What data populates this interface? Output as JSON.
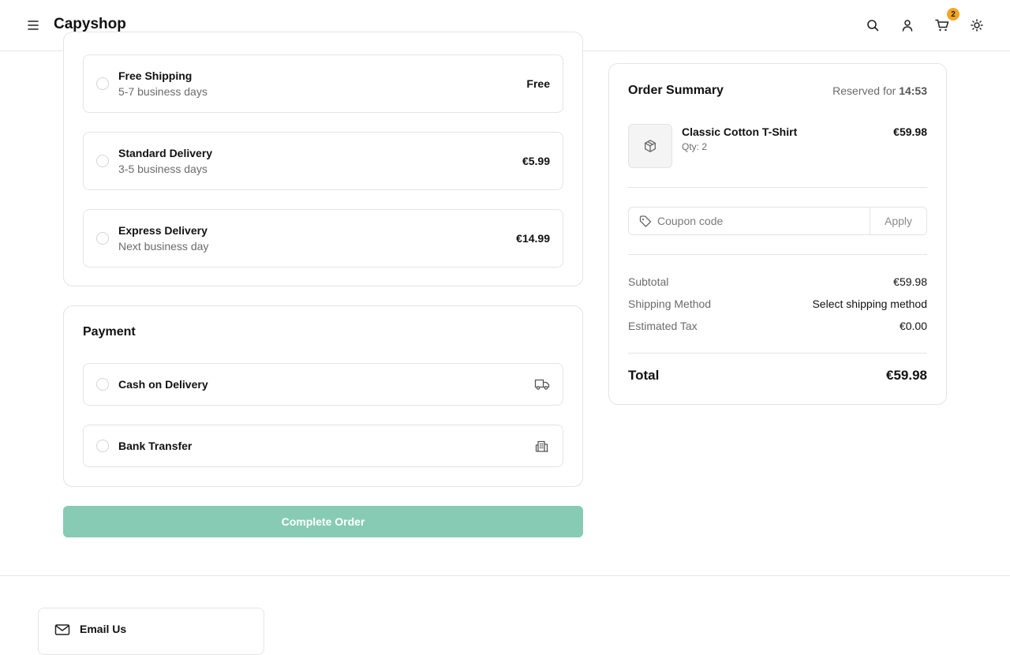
{
  "header": {
    "brand": "Capyshop",
    "cart_count": "2",
    "icons": [
      "menu-icon",
      "search-icon",
      "user-icon",
      "cart-icon",
      "sun-icon"
    ]
  },
  "shipping": {
    "options": [
      {
        "title": "Free Shipping",
        "subtitle": "5-7 business days",
        "price": "Free"
      },
      {
        "title": "Standard Delivery",
        "subtitle": "3-5 business days",
        "price": "€5.99"
      },
      {
        "title": "Express Delivery",
        "subtitle": "Next business day",
        "price": "€14.99"
      }
    ]
  },
  "payment": {
    "title": "Payment",
    "options": [
      {
        "label": "Cash on Delivery",
        "icon": "truck-icon"
      },
      {
        "label": "Bank Transfer",
        "icon": "building-icon"
      }
    ]
  },
  "complete_button": "Complete Order",
  "summary": {
    "title": "Order Summary",
    "reserved_label": "Reserved for",
    "reserved_time": "14:53",
    "item": {
      "name": "Classic Cotton T-Shirt",
      "qty": "Qty: 2",
      "price": "€59.98",
      "icon": "package-icon"
    },
    "coupon": {
      "placeholder": "Coupon code",
      "apply": "Apply",
      "icon": "tag-icon"
    },
    "rows": [
      {
        "label": "Subtotal",
        "value": "€59.98"
      },
      {
        "label": "Shipping Method",
        "value": "Select shipping method"
      },
      {
        "label": "Estimated Tax",
        "value": "€0.00"
      }
    ],
    "total_label": "Total",
    "total_value": "€59.98"
  },
  "footer": {
    "contact_title": "Email Us",
    "contact_icon": "mail-icon"
  },
  "colors": {
    "accent_button": "#87cbb4",
    "badge": "#f5a524",
    "border": "#e4e4e7"
  }
}
